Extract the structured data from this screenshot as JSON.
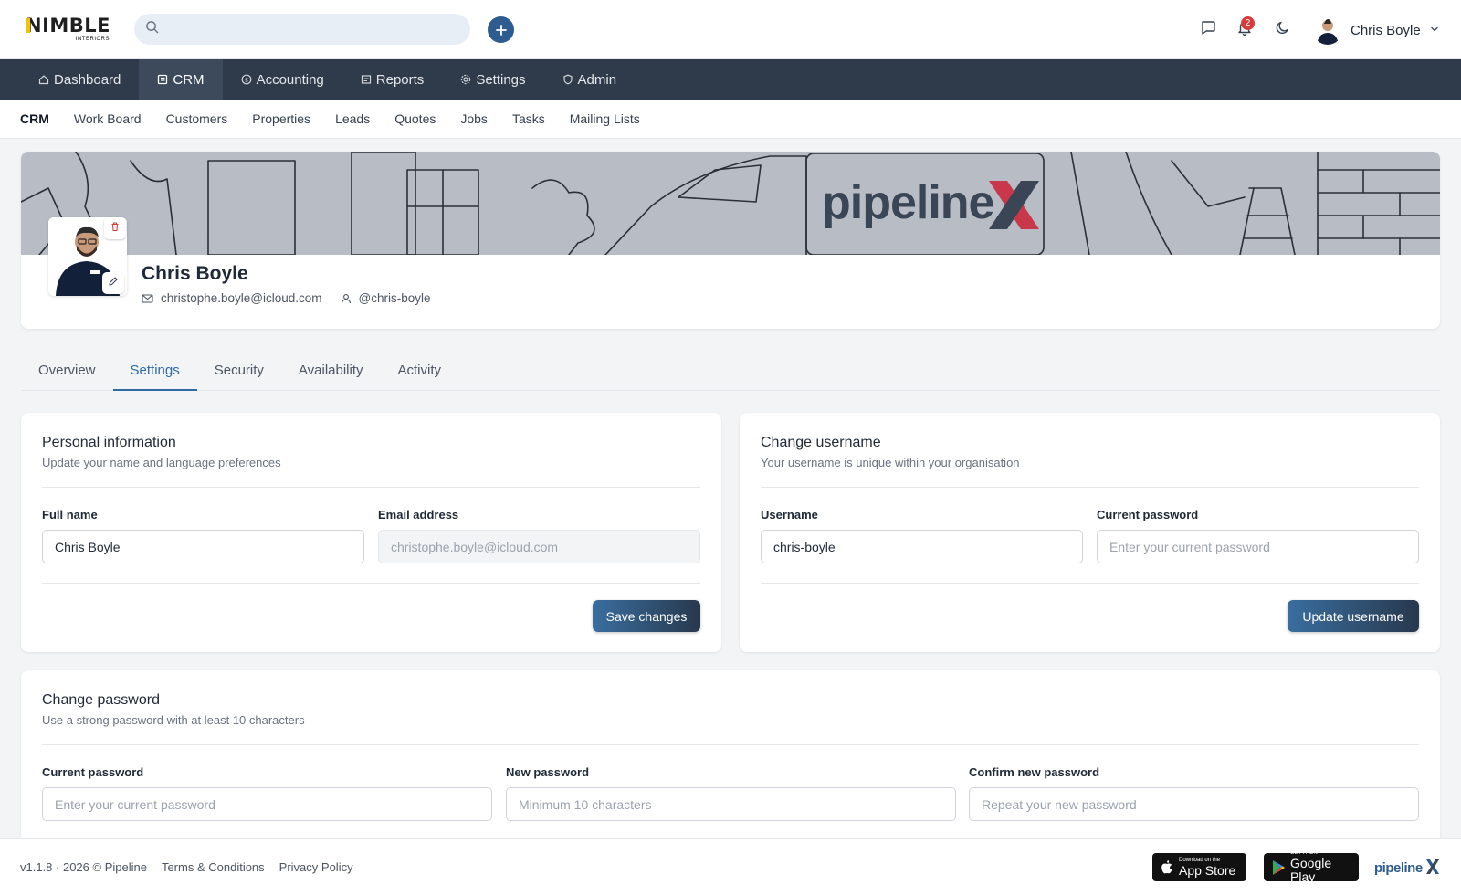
{
  "header": {
    "logo_text": "NIMBLE",
    "logo_subtext": "INTERIORS",
    "search_placeholder": "",
    "notification_count": "2",
    "user_name": "Chris Boyle",
    "icons": [
      "search-icon",
      "plus-icon",
      "chat-icon",
      "bell-icon",
      "moon-icon",
      "chevron-down-icon"
    ]
  },
  "main_nav": {
    "items": [
      {
        "label": "Dashboard",
        "icon": "home-icon",
        "active": false
      },
      {
        "label": "CRM",
        "icon": "crm-icon",
        "active": true
      },
      {
        "label": "Accounting",
        "icon": "coin-icon",
        "active": false
      },
      {
        "label": "Reports",
        "icon": "report-icon",
        "active": false
      },
      {
        "label": "Settings",
        "icon": "gear-icon",
        "active": false
      },
      {
        "label": "Admin",
        "icon": "shield-icon",
        "active": false
      }
    ]
  },
  "sub_nav": {
    "items": [
      {
        "label": "CRM",
        "active": true
      },
      {
        "label": "Work Board",
        "active": false
      },
      {
        "label": "Customers",
        "active": false
      },
      {
        "label": "Properties",
        "active": false
      },
      {
        "label": "Leads",
        "active": false
      },
      {
        "label": "Quotes",
        "active": false
      },
      {
        "label": "Jobs",
        "active": false
      },
      {
        "label": "Tasks",
        "active": false
      },
      {
        "label": "Mailing Lists",
        "active": false
      }
    ]
  },
  "profile": {
    "banner_logo": "pipeline",
    "name": "Chris Boyle",
    "email": "christophe.boyle@icloud.com",
    "username": "@chris-boyle"
  },
  "tabs": {
    "items": [
      {
        "label": "Overview",
        "active": false
      },
      {
        "label": "Settings",
        "active": true
      },
      {
        "label": "Security",
        "active": false
      },
      {
        "label": "Availability",
        "active": false
      },
      {
        "label": "Activity",
        "active": false
      }
    ]
  },
  "personal_info": {
    "title": "Personal information",
    "subtitle": "Update your name and language preferences",
    "full_name_label": "Full name",
    "full_name_value": "Chris Boyle",
    "email_label": "Email address",
    "email_value": "christophe.boyle@icloud.com",
    "save_label": "Save changes"
  },
  "change_username": {
    "title": "Change username",
    "subtitle": "Your username is unique within your organisation",
    "username_label": "Username",
    "username_value": "chris-boyle",
    "password_label": "Current password",
    "password_placeholder": "Enter your current password",
    "button_label": "Update username"
  },
  "change_password": {
    "title": "Change password",
    "subtitle": "Use a strong password with at least 10 characters",
    "current_label": "Current password",
    "current_placeholder": "Enter your current password",
    "new_label": "New password",
    "new_placeholder": "Minimum 10 characters",
    "confirm_label": "Confirm new password",
    "confirm_placeholder": "Repeat your new password"
  },
  "footer": {
    "version": "v1.1.8 · 2026 © Pipeline",
    "terms": "Terms & Conditions",
    "privacy": "Privacy Policy",
    "app_store_small": "Download on the",
    "app_store_big": "App Store",
    "google_play_small": "GET IT ON",
    "google_play_big": "Google Play",
    "logo": "pipeline"
  },
  "colors": {
    "nav_bg": "#2f3a4a",
    "accent": "#2f6aa3",
    "badge": "#d93b3b",
    "banner_x_red": "#c8384a"
  }
}
